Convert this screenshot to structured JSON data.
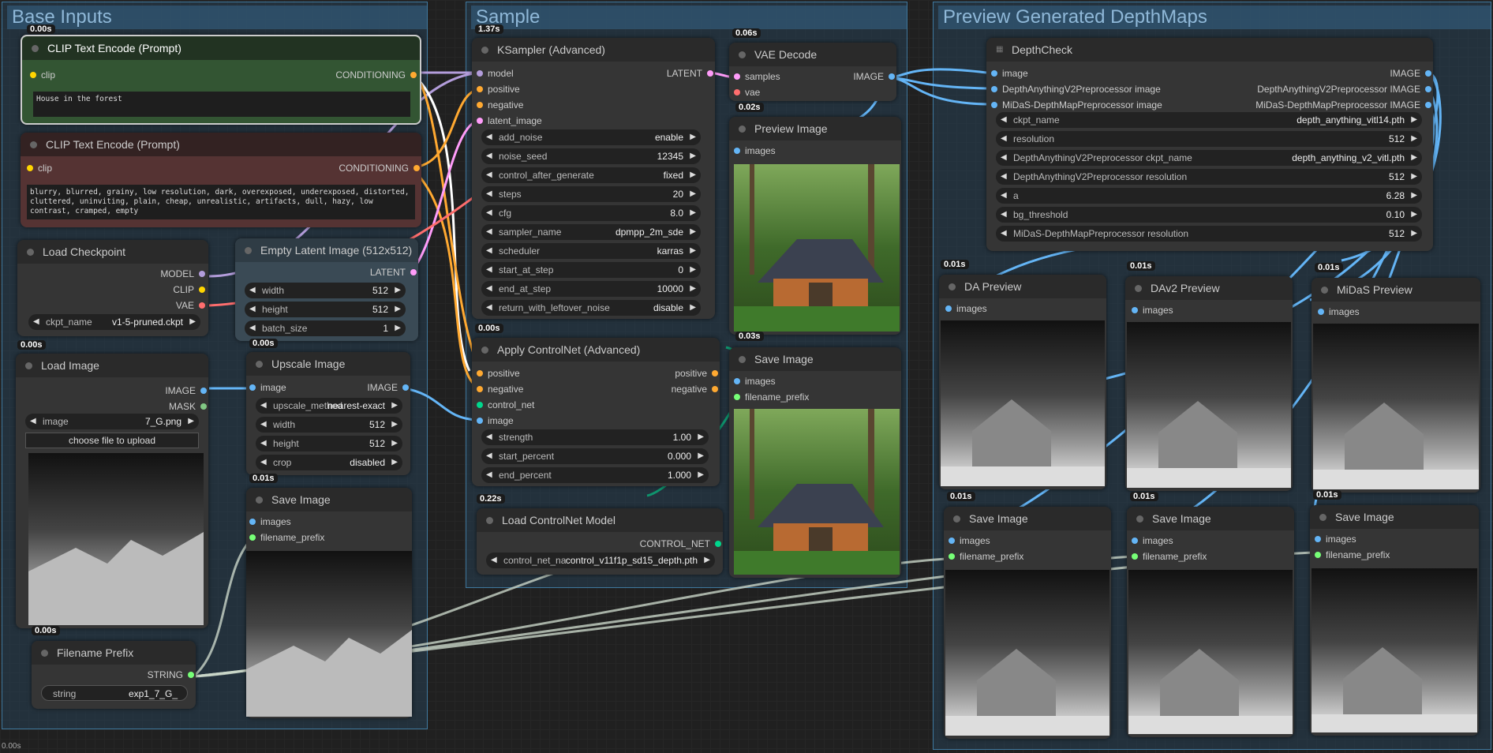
{
  "groups": {
    "base": "Base Inputs",
    "sample": "Sample",
    "preview": "Preview Generated DepthMaps"
  },
  "colors": {
    "clip": "#ffd500",
    "cond": "#ffa931",
    "model": "#b39ddb",
    "latent": "#ff9cf9",
    "vae": "#ff6e6e",
    "image": "#64b5f6",
    "mask": "#81c784",
    "string": "#77ff77",
    "control": "#00d78d"
  },
  "nodes": {
    "clip_pos": {
      "title": "CLIP Text Encode (Prompt)",
      "in": "clip",
      "out": "CONDITIONING",
      "text": "House in the forest",
      "time": "0.00s"
    },
    "clip_neg": {
      "title": "CLIP Text Encode (Prompt)",
      "in": "clip",
      "out": "CONDITIONING",
      "text": "blurry, blurred, grainy, low resolution, dark, overexposed, underexposed, distorted, cluttered, uninviting, plain, cheap, unrealistic, artifacts, dull, hazy, low contrast, cramped, empty"
    },
    "ckpt": {
      "title": "Load Checkpoint",
      "o1": "MODEL",
      "o2": "CLIP",
      "o3": "VAE",
      "w_label": "ckpt_name",
      "w_value": "v1-5-pruned.ckpt",
      "time": "0.00s"
    },
    "latent": {
      "title": "Empty Latent Image (512x512)",
      "out": "LATENT",
      "width_l": "width",
      "width_v": "512",
      "height_l": "height",
      "height_v": "512",
      "batch_l": "batch_size",
      "batch_v": "1",
      "time": "0.00s"
    },
    "loadimg": {
      "title": "Load Image",
      "o1": "IMAGE",
      "o2": "MASK",
      "w_label": "image",
      "w_value": "7_G.png",
      "btn": "choose file to upload",
      "time": "0.00s"
    },
    "upscale": {
      "title": "Upscale Image",
      "in": "image",
      "out": "IMAGE",
      "m_l": "upscale_method",
      "m_v": "nearest-exact",
      "w_l": "width",
      "w_v": "512",
      "h_l": "height",
      "h_v": "512",
      "c_l": "crop",
      "c_v": "disabled",
      "time": "0.01s"
    },
    "save1": {
      "title": "Save Image",
      "i1": "images",
      "i2": "filename_prefix"
    },
    "prefix": {
      "title": "Filename Prefix",
      "out": "STRING",
      "w_label": "string",
      "w_value": "exp1_7_G_"
    },
    "ksampler": {
      "title": "KSampler (Advanced)",
      "time": "1.37s",
      "inputs": [
        "model",
        "positive",
        "negative",
        "latent_image"
      ],
      "out": "LATENT",
      "widgets": [
        [
          "add_noise",
          "enable"
        ],
        [
          "noise_seed",
          "12345"
        ],
        [
          "control_after_generate",
          "fixed"
        ],
        [
          "steps",
          "20"
        ],
        [
          "cfg",
          "8.0"
        ],
        [
          "sampler_name",
          "dpmpp_2m_sde"
        ],
        [
          "scheduler",
          "karras"
        ],
        [
          "start_at_step",
          "0"
        ],
        [
          "end_at_step",
          "10000"
        ],
        [
          "return_with_leftover_noise",
          "disable"
        ]
      ]
    },
    "vaedec": {
      "title": "VAE Decode",
      "i1": "samples",
      "i2": "vae",
      "out": "IMAGE",
      "time": "0.06s"
    },
    "preview": {
      "title": "Preview Image",
      "in": "images",
      "time": "0.02s"
    },
    "controlnet": {
      "title": "Apply ControlNet (Advanced)",
      "time": "0.00s",
      "inputs": [
        "positive",
        "negative",
        "control_net",
        "image"
      ],
      "o1": "positive",
      "o2": "negative",
      "widgets": [
        [
          "strength",
          "1.00"
        ],
        [
          "start_percent",
          "0.000"
        ],
        [
          "end_percent",
          "1.000"
        ]
      ]
    },
    "save2": {
      "title": "Save Image",
      "i1": "images",
      "i2": "filename_prefix",
      "time": "0.03s"
    },
    "loadcn": {
      "title": "Load ControlNet Model",
      "out": "CONTROL_NET",
      "w_label": "control_net_name",
      "w_value": "control_v11f1p_sd15_depth.pth",
      "time": "0.22s"
    },
    "depthcheck": {
      "title": "DepthCheck",
      "inputs": [
        "image",
        "DepthAnythingV2Preprocessor image",
        "MiDaS-DepthMapPreprocessor image"
      ],
      "outputs": [
        "IMAGE",
        "DepthAnythingV2Preprocessor IMAGE",
        "MiDaS-DepthMapPreprocessor IMAGE"
      ],
      "widgets": [
        [
          "ckpt_name",
          "depth_anything_vitl14.pth"
        ],
        [
          "resolution",
          "512"
        ],
        [
          "DepthAnythingV2Preprocessor ckpt_name",
          "depth_anything_v2_vitl.pth"
        ],
        [
          "DepthAnythingV2Preprocessor resolution",
          "512"
        ],
        [
          "a",
          "6.28"
        ],
        [
          "bg_threshold",
          "0.10"
        ],
        [
          "MiDaS-DepthMapPreprocessor resolution",
          "512"
        ]
      ]
    },
    "da": {
      "title": "DA Preview",
      "in": "images",
      "time": "0.01s"
    },
    "dav2": {
      "title": "DAv2 Preview",
      "in": "images",
      "time": "0.01s"
    },
    "midas": {
      "title": "MiDaS Preview",
      "in": "images",
      "time": "0.01s"
    },
    "save3": {
      "title": "Save Image",
      "i1": "images",
      "i2": "filename_prefix",
      "time": "0.01s"
    },
    "save4": {
      "title": "Save Image",
      "i1": "images",
      "i2": "filename_prefix",
      "time": "0.01s"
    },
    "save5": {
      "title": "Save Image",
      "i1": "images",
      "i2": "filename_prefix",
      "time": "0.01s"
    }
  },
  "footer": "0.00s"
}
